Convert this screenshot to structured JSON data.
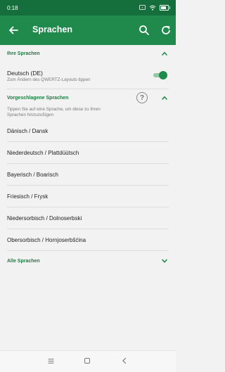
{
  "status_bar": {
    "time": "0:18",
    "battery_level": 0.8
  },
  "app_bar": {
    "title": "Sprachen",
    "icons": [
      "arrow-back-icon",
      "search-icon",
      "refresh-icon"
    ]
  },
  "your_languages": {
    "header": "Ihre Sprachen",
    "items": [
      {
        "name": "Deutsch (DE)",
        "subtitle": "Zum Ändern des QWERTZ-Layouts tippen",
        "enabled": true
      }
    ]
  },
  "suggested": {
    "header": "Vorgeschlagene Sprachen",
    "hint": "Tippen Sie auf eine Sprache, um diese zu Ihren Sprachen hinzuzufügen",
    "items": [
      "Dänisch / Dansk",
      "Niederdeutsch / Plattdüütsch",
      "Bayerisch / Boarisch",
      "Friesisch / Frysk",
      "Niedersorbisch / Dolnoserbski",
      "Obersorbisch / Hornjoserbšćina"
    ]
  },
  "all_languages": {
    "header": "Alle Sprachen"
  },
  "colors": {
    "status_bar": "#156f3c",
    "app_bar": "#1f8a4c",
    "accent_text": "#1f7a43",
    "background": "#f2f2f2"
  }
}
